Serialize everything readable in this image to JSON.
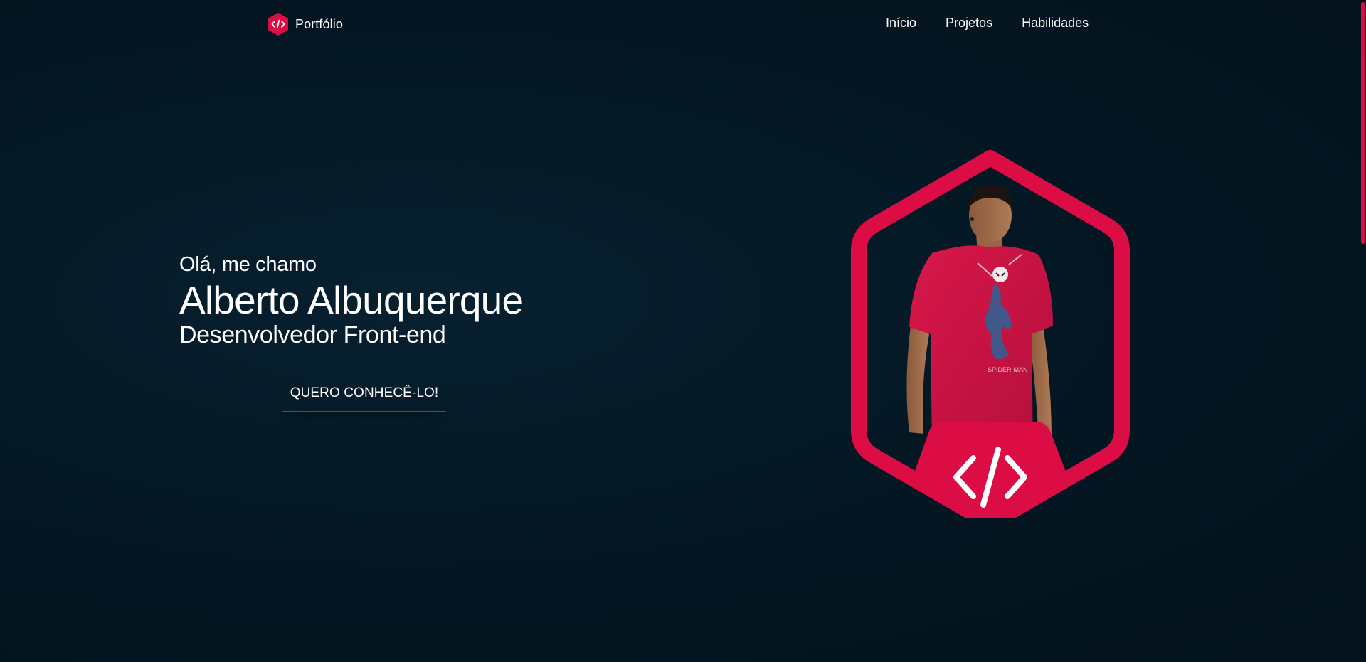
{
  "header": {
    "logo_icon": "code-hexagon-icon",
    "logo_text": "Portfólio",
    "nav": [
      {
        "label": "Início"
      },
      {
        "label": "Projetos"
      },
      {
        "label": "Habilidades"
      }
    ]
  },
  "hero": {
    "greeting": "Olá, me chamo",
    "name": "Alberto Albuquerque",
    "role": "Desenvolvedor Front-end",
    "cta_label": "QUERO CONHECÊ-LO!"
  },
  "portrait": {
    "frame_icon": "code-brackets-icon",
    "shirt_text": "SPIDER-MAN"
  },
  "colors": {
    "accent": "#dc0d45",
    "background": "#041521",
    "text": "#ffffff"
  }
}
